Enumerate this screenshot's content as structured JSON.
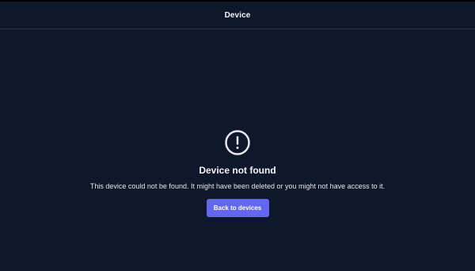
{
  "header": {
    "title": "Device"
  },
  "empty_state": {
    "icon": "exclamation-circle-icon",
    "title": "Device not found",
    "message": "This device could not be found. It might have been deleted or you might not have access to it.",
    "button_label": "Back to devices"
  },
  "colors": {
    "background": "#0f172a",
    "accent": "#6366f1",
    "text": "#e5e7eb"
  }
}
